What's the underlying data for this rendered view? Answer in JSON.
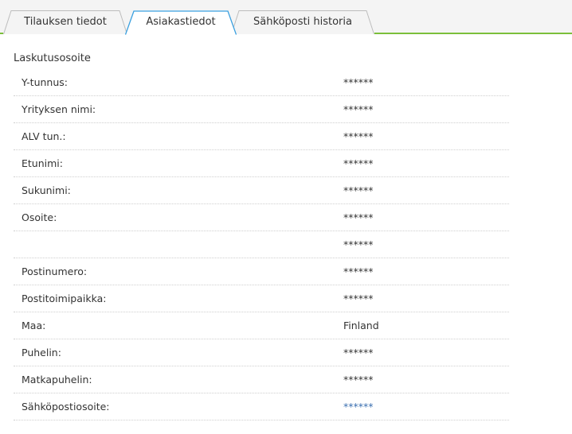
{
  "tabs": [
    {
      "label": "Tilauksen tiedot",
      "active": false
    },
    {
      "label": "Asiakastiedot",
      "active": true
    },
    {
      "label": "Sähköposti historia",
      "active": false
    }
  ],
  "colors": {
    "accent": "#7bbf3a",
    "active_tab_border": "#3aa0e0",
    "link": "#3a6fb0"
  },
  "section": {
    "title": "Laskutusosoite"
  },
  "rows": [
    {
      "label": "Y-tunnus:",
      "value": "******"
    },
    {
      "label": "Yrityksen nimi:",
      "value": "******"
    },
    {
      "label": "ALV tun.:",
      "value": "******"
    },
    {
      "label": "Etunimi:",
      "value": "******"
    },
    {
      "label": "Sukunimi:",
      "value": "******"
    },
    {
      "label": "Osoite:",
      "value": "******"
    },
    {
      "label": "",
      "value": "******"
    },
    {
      "label": "Postinumero:",
      "value": "******"
    },
    {
      "label": "Postitoimipaikka:",
      "value": "******"
    },
    {
      "label": "Maa:",
      "value": "Finland"
    },
    {
      "label": "Puhelin:",
      "value": "******"
    },
    {
      "label": "Matkapuhelin:",
      "value": "******"
    },
    {
      "label": "Sähköpostiosoite:",
      "value": "******"
    }
  ]
}
